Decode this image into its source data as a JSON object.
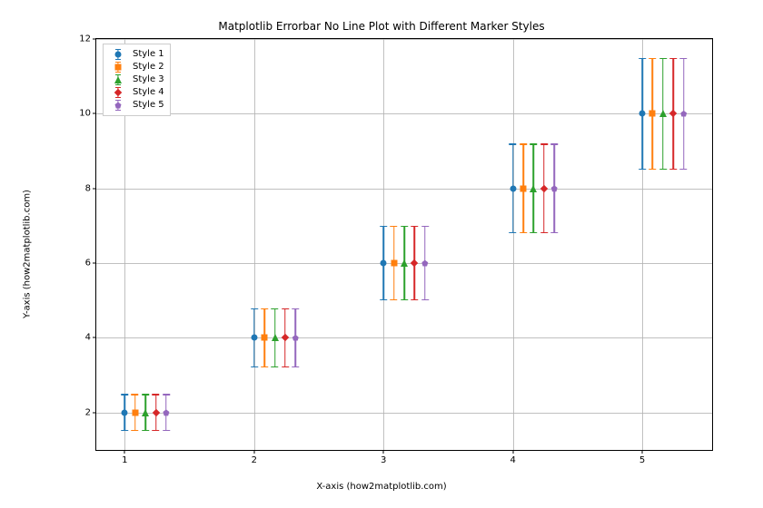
{
  "chart_data": {
    "type": "scatter",
    "title": "Matplotlib Errorbar No Line Plot with Different Marker Styles",
    "xlabel": "X-axis (how2matplotlib.com)",
    "ylabel": "Y-axis (how2matplotlib.com)",
    "x": [
      1,
      2,
      3,
      4,
      5
    ],
    "series": [
      {
        "name": "Style 1",
        "color": "#1f77b4",
        "marker_shape": "circle",
        "offset": 0.0,
        "values": [
          2,
          4,
          6,
          8,
          10
        ],
        "yerr": [
          0.5,
          0.8,
          1.0,
          1.2,
          1.5
        ]
      },
      {
        "name": "Style 2",
        "color": "#ff7f0e",
        "marker_shape": "square",
        "offset": 0.08,
        "values": [
          2,
          4,
          6,
          8,
          10
        ],
        "yerr": [
          0.5,
          0.8,
          1.0,
          1.2,
          1.5
        ]
      },
      {
        "name": "Style 3",
        "color": "#2ca02c",
        "marker_shape": "tri",
        "offset": 0.16,
        "values": [
          2,
          4,
          6,
          8,
          10
        ],
        "yerr": [
          0.5,
          0.8,
          1.0,
          1.2,
          1.5
        ]
      },
      {
        "name": "Style 4",
        "color": "#d62728",
        "marker_shape": "diamond",
        "offset": 0.24,
        "values": [
          2,
          4,
          6,
          8,
          10
        ],
        "yerr": [
          0.5,
          0.8,
          1.0,
          1.2,
          1.5
        ]
      },
      {
        "name": "Style 5",
        "color": "#9467bd",
        "marker_shape": "pent",
        "offset": 0.32,
        "values": [
          2,
          4,
          6,
          8,
          10
        ],
        "yerr": [
          0.5,
          0.8,
          1.0,
          1.2,
          1.5
        ]
      }
    ],
    "xlim": [
      0.78,
      5.54
    ],
    "ylim": [
      1.0,
      12.0
    ],
    "xticks": [
      1,
      2,
      3,
      4,
      5
    ],
    "yticks": [
      2,
      4,
      6,
      8,
      10,
      12
    ],
    "grid": true,
    "legend_position": "upper-left"
  }
}
